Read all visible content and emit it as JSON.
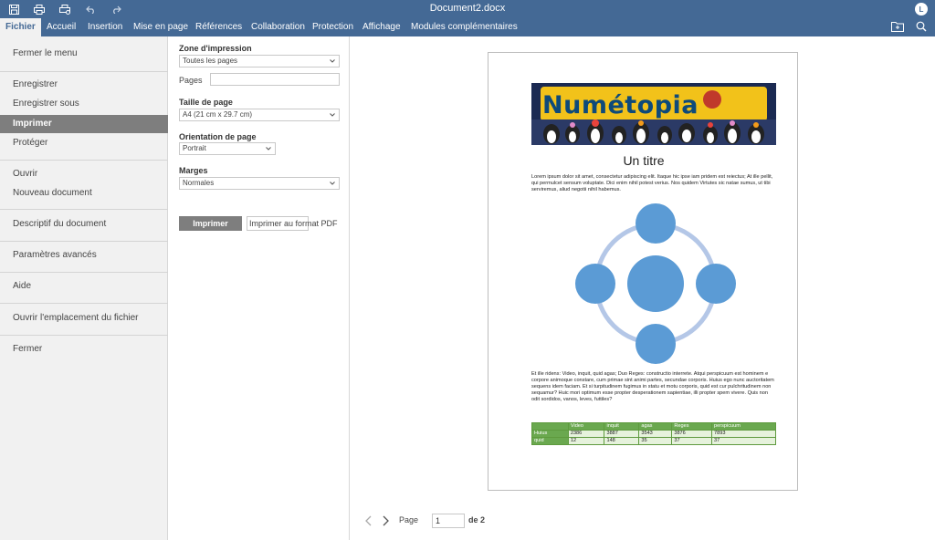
{
  "window": {
    "title": "Document2.docx",
    "user_initial": "L"
  },
  "tabs": [
    {
      "label": "Fichier"
    },
    {
      "label": "Accueil"
    },
    {
      "label": "Insertion"
    },
    {
      "label": "Mise en page"
    },
    {
      "label": "Références"
    },
    {
      "label": "Collaboration"
    },
    {
      "label": "Protection"
    },
    {
      "label": "Affichage"
    },
    {
      "label": "Modules complémentaires"
    }
  ],
  "left_menu": {
    "items": [
      {
        "label": "Fermer le menu"
      },
      {
        "label": "Enregistrer"
      },
      {
        "label": "Enregistrer sous"
      },
      {
        "label": "Imprimer"
      },
      {
        "label": "Protéger"
      },
      {
        "label": "Ouvrir"
      },
      {
        "label": "Nouveau document"
      },
      {
        "label": "Descriptif du document"
      },
      {
        "label": "Paramètres avancés"
      },
      {
        "label": "Aide"
      },
      {
        "label": "Ouvrir l'emplacement du fichier"
      },
      {
        "label": "Fermer"
      }
    ],
    "active": "Imprimer"
  },
  "print_panel": {
    "zone_label": "Zone d'impression",
    "zone_value": "Toutes les pages",
    "pages_label": "Pages",
    "pages_value": "",
    "size_label": "Taille de page",
    "size_value": "A4 (21 cm x 29.7 cm)",
    "orientation_label": "Orientation de page",
    "orientation_value": "Portrait",
    "margins_label": "Marges",
    "margins_value": "Normales",
    "print_button": "Imprimer",
    "pdf_button": "Imprimer au format PDF"
  },
  "preview": {
    "banner_text": "Numétopia",
    "doc_title": "Un titre",
    "para1": "Lorem ipsum dolor sit amet, consectetur adipiscing elit. Itaque hic ipse iam pridem est reiectus; At ille pellit, qui permulcet sensum voluptate. Dici enim nihil potest verius. Nos quidem Virtutes sic natae sumus, ut tibi serviremus, aliud negotii nihil habemus.",
    "para2": "Et ille ridens: Video, inquit, quid agas; Duo Reges: constructio interrete. Atqui perspicuum est hominem e corpore animoque constare, cum primae sint animi partes, secundae corporis. Huius ego nunc auctoritatem sequens idem faciam. Et si turpitudinem fugimus in statu et motu corporis, quid est cur pulchritudinem non sequamur? Huic mori optimum esse propter desperationem sapientiae, illi propter spem vivere. Quis non odit sordidos, vanos, leves, futtiles?",
    "table": {
      "headers": [
        "",
        "Video",
        "inquit",
        "agas",
        "Reges",
        "perspicuum"
      ],
      "rows": [
        [
          "Huius",
          "2386",
          "3887",
          "3543",
          "3876",
          "7893"
        ],
        [
          "quid",
          "12",
          "148",
          "35",
          "37",
          "37"
        ]
      ]
    },
    "colors": {
      "circle": "#5b9bd5",
      "ring": "#b4c7e7",
      "table_header": "#6aa84f",
      "table_body": "#e6f2dc"
    },
    "pager": {
      "page_label": "Page",
      "page_value": "1",
      "of_label": "de 2"
    }
  },
  "theme": {
    "header_bg": "#446995",
    "menu_bg": "#f1f1f1",
    "active_item_bg": "#7e7e7e"
  }
}
